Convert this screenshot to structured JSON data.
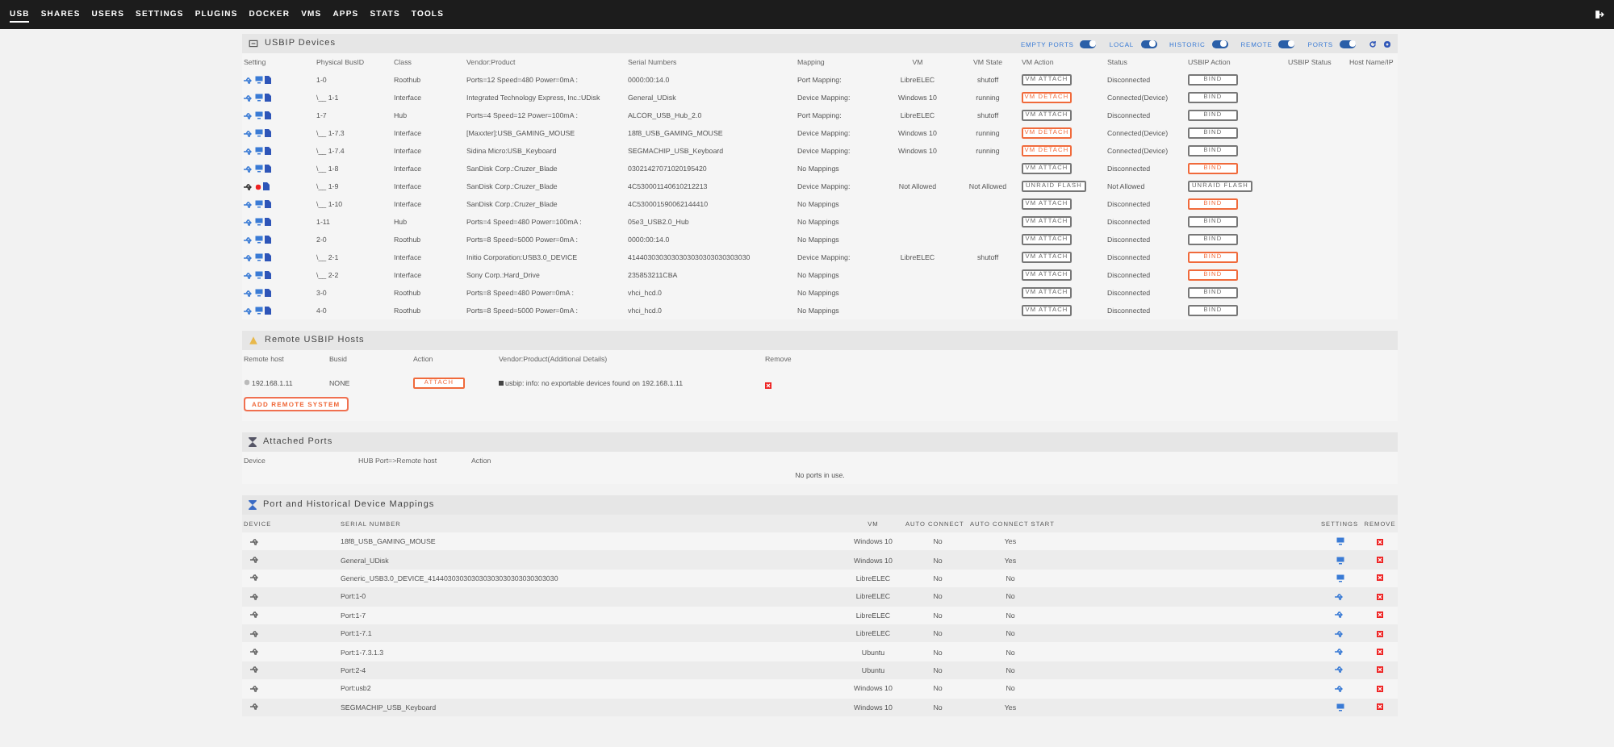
{
  "nav": [
    {
      "label": "USB",
      "selected": true
    },
    {
      "label": "SHARES",
      "selected": false
    },
    {
      "label": "USERS",
      "selected": false
    },
    {
      "label": "SETTINGS",
      "selected": false
    },
    {
      "label": "PLUGINS",
      "selected": false
    },
    {
      "label": "DOCKER",
      "selected": false
    },
    {
      "label": "VMS",
      "selected": false
    },
    {
      "label": "APPS",
      "selected": false
    },
    {
      "label": "STATS",
      "selected": false
    },
    {
      "label": "TOOLS",
      "selected": false
    }
  ],
  "devices": {
    "title": "USBIP Devices",
    "toggles": [
      {
        "label": "EMPTY PORTS",
        "on": true
      },
      {
        "label": "LOCAL",
        "on": true
      },
      {
        "label": "HISTORIC",
        "on": true
      },
      {
        "label": "REMOTE",
        "on": true
      },
      {
        "label": "PORTS",
        "on": true
      }
    ],
    "columns": [
      "Setting",
      "Physical BusID",
      "Class",
      "Vendor:Product",
      "Serial Numbers",
      "Mapping",
      "VM",
      "VM State",
      "VM Action",
      "Status",
      "USBIP Action",
      "USBIP Status",
      "Host Name/IP"
    ],
    "rows": [
      {
        "vm_allowed": true,
        "busid": "1-0",
        "class": "Roothub",
        "vendor": "Ports=12 Speed=480 Power=0mA :",
        "serial": "0000:00:14.0",
        "mapping": "Port Mapping:",
        "vm": "LibreELEC",
        "vm_state": "shutoff",
        "vm_action": {
          "label": "VM ATTACH",
          "kind": "attach"
        },
        "status": "Disconnected",
        "usbip_action": {
          "label": "BIND",
          "highlighted": false
        }
      },
      {
        "vm_allowed": true,
        "busid": "\\__ 1-1",
        "class": "Interface",
        "vendor": "Integrated Technology Express, Inc.:UDisk",
        "serial": "General_UDisk",
        "mapping": "Device Mapping:",
        "vm": "Windows 10",
        "vm_state": "running",
        "vm_action": {
          "label": "VM DETACH",
          "kind": "detach"
        },
        "status": "Connected(Device)",
        "usbip_action": {
          "label": "BIND",
          "highlighted": false
        }
      },
      {
        "vm_allowed": true,
        "busid": "1-7",
        "class": "Hub",
        "vendor": "Ports=4 Speed=12 Power=100mA :",
        "serial": "ALCOR_USB_Hub_2.0",
        "mapping": "Port Mapping:",
        "vm": "LibreELEC",
        "vm_state": "shutoff",
        "vm_action": {
          "label": "VM ATTACH",
          "kind": "attach"
        },
        "status": "Disconnected",
        "usbip_action": {
          "label": "BIND",
          "highlighted": false
        }
      },
      {
        "vm_allowed": true,
        "busid": "\\__ 1-7.3",
        "class": "Interface",
        "vendor": "[Maxxter]:USB_GAMING_MOUSE",
        "serial": "18f8_USB_GAMING_MOUSE",
        "mapping": "Device Mapping:",
        "vm": "Windows 10",
        "vm_state": "running",
        "vm_action": {
          "label": "VM DETACH",
          "kind": "detach"
        },
        "status": "Connected(Device)",
        "usbip_action": {
          "label": "BIND",
          "highlighted": false
        }
      },
      {
        "vm_allowed": true,
        "busid": "\\__ 1-7.4",
        "class": "Interface",
        "vendor": "Sidina Micro:USB_Keyboard",
        "serial": "SEGMACHIP_USB_Keyboard",
        "mapping": "Device Mapping:",
        "vm": "Windows 10",
        "vm_state": "running",
        "vm_action": {
          "label": "VM DETACH",
          "kind": "detach"
        },
        "status": "Connected(Device)",
        "usbip_action": {
          "label": "BIND",
          "highlighted": false
        }
      },
      {
        "vm_allowed": true,
        "busid": "\\__ 1-8",
        "class": "Interface",
        "vendor": "SanDisk Corp.:Cruzer_Blade",
        "serial": "03021427071020195420",
        "mapping": "No Mappings",
        "vm": "",
        "vm_state": "",
        "vm_action": {
          "label": "VM ATTACH",
          "kind": "attach"
        },
        "status": "Disconnected",
        "usbip_action": {
          "label": "BIND",
          "highlighted": true
        }
      },
      {
        "vm_allowed": false,
        "busid": "\\__ 1-9",
        "class": "Interface",
        "vendor": "SanDisk Corp.:Cruzer_Blade",
        "serial": "4C530001140610212213",
        "mapping": "Device Mapping:",
        "vm": "Not Allowed",
        "vm_state": "Not Allowed",
        "vm_action": {
          "label": "UNRAID FLASH",
          "kind": "flash"
        },
        "status": "Not Allowed",
        "usbip_action": {
          "label": "UNRAID FLASH",
          "highlighted": false
        }
      },
      {
        "vm_allowed": true,
        "busid": "\\__ 1-10",
        "class": "Interface",
        "vendor": "SanDisk Corp.:Cruzer_Blade",
        "serial": "4C530001590062144410",
        "mapping": "No Mappings",
        "vm": "",
        "vm_state": "",
        "vm_action": {
          "label": "VM ATTACH",
          "kind": "attach"
        },
        "status": "Disconnected",
        "usbip_action": {
          "label": "BIND",
          "highlighted": true
        }
      },
      {
        "vm_allowed": true,
        "busid": "1-11",
        "class": "Hub",
        "vendor": "Ports=4 Speed=480 Power=100mA :",
        "serial": "05e3_USB2.0_Hub",
        "mapping": "No Mappings",
        "vm": "",
        "vm_state": "",
        "vm_action": {
          "label": "VM ATTACH",
          "kind": "attach"
        },
        "status": "Disconnected",
        "usbip_action": {
          "label": "BIND",
          "highlighted": false
        }
      },
      {
        "vm_allowed": true,
        "busid": "2-0",
        "class": "Roothub",
        "vendor": "Ports=8 Speed=5000 Power=0mA :",
        "serial": "0000:00:14.0",
        "mapping": "No Mappings",
        "vm": "",
        "vm_state": "",
        "vm_action": {
          "label": "VM ATTACH",
          "kind": "attach"
        },
        "status": "Disconnected",
        "usbip_action": {
          "label": "BIND",
          "highlighted": false
        }
      },
      {
        "vm_allowed": true,
        "busid": "\\__ 2-1",
        "class": "Interface",
        "vendor": "Initio Corporation:USB3.0_DEVICE",
        "serial": "4144030303030303030303030303030",
        "mapping": "Device Mapping:",
        "vm": "LibreELEC",
        "vm_state": "shutoff",
        "vm_action": {
          "label": "VM ATTACH",
          "kind": "attach"
        },
        "status": "Disconnected",
        "usbip_action": {
          "label": "BIND",
          "highlighted": true
        }
      },
      {
        "vm_allowed": true,
        "busid": "\\__ 2-2",
        "class": "Interface",
        "vendor": "Sony Corp.:Hard_Drive",
        "serial": "235853211CBA",
        "mapping": "No Mappings",
        "vm": "",
        "vm_state": "",
        "vm_action": {
          "label": "VM ATTACH",
          "kind": "attach"
        },
        "status": "Disconnected",
        "usbip_action": {
          "label": "BIND",
          "highlighted": true
        }
      },
      {
        "vm_allowed": true,
        "busid": "3-0",
        "class": "Roothub",
        "vendor": "Ports=8 Speed=480 Power=0mA :",
        "serial": "vhci_hcd.0",
        "mapping": "No Mappings",
        "vm": "",
        "vm_state": "",
        "vm_action": {
          "label": "VM ATTACH",
          "kind": "attach"
        },
        "status": "Disconnected",
        "usbip_action": {
          "label": "BIND",
          "highlighted": false
        }
      },
      {
        "vm_allowed": true,
        "busid": "4-0",
        "class": "Roothub",
        "vendor": "Ports=8 Speed=5000 Power=0mA :",
        "serial": "vhci_hcd.0",
        "mapping": "No Mappings",
        "vm": "",
        "vm_state": "",
        "vm_action": {
          "label": "VM ATTACH",
          "kind": "attach"
        },
        "status": "Disconnected",
        "usbip_action": {
          "label": "BIND",
          "highlighted": false
        }
      }
    ]
  },
  "remote": {
    "title": "Remote USBIP Hosts",
    "columns": [
      "Remote host",
      "Busid",
      "Action",
      "Vendor:Product(Additional Details)",
      "Remove"
    ],
    "rows": [
      {
        "host": "192.168.1.11",
        "busid": "NONE",
        "action": "ATTACH",
        "details": "usbip: info: no exportable devices found on 192.168.1.11"
      }
    ],
    "add_button": "ADD REMOTE SYSTEM"
  },
  "attached": {
    "title": "Attached Ports",
    "columns": [
      "Device",
      "HUB Port=>Remote host",
      "Action"
    ],
    "empty_text": "No ports in use."
  },
  "mappings": {
    "title": "Port and Historical Device Mappings",
    "columns": [
      "DEVICE",
      "SERIAL NUMBER",
      "VM",
      "AUTO CONNECT",
      "AUTO CONNECT START",
      "SETTINGS",
      "REMOVE"
    ],
    "rows": [
      {
        "serial": "18f8_USB_GAMING_MOUSE",
        "vm": "Windows 10",
        "auto_connect": "No",
        "auto_connect_start": "Yes",
        "kind": "device"
      },
      {
        "serial": "General_UDisk",
        "vm": "Windows 10",
        "auto_connect": "No",
        "auto_connect_start": "Yes",
        "kind": "device"
      },
      {
        "serial": "Generic_USB3.0_DEVICE_414403030303030303030303030303030",
        "vm": "LibreELEC",
        "auto_connect": "No",
        "auto_connect_start": "No",
        "kind": "device"
      },
      {
        "serial": "Port:1-0",
        "vm": "LibreELEC",
        "auto_connect": "No",
        "auto_connect_start": "No",
        "kind": "port"
      },
      {
        "serial": "Port:1-7",
        "vm": "LibreELEC",
        "auto_connect": "No",
        "auto_connect_start": "No",
        "kind": "port"
      },
      {
        "serial": "Port:1-7.1",
        "vm": "LibreELEC",
        "auto_connect": "No",
        "auto_connect_start": "No",
        "kind": "port"
      },
      {
        "serial": "Port:1-7.3.1.3",
        "vm": "Ubuntu",
        "auto_connect": "No",
        "auto_connect_start": "No",
        "kind": "port"
      },
      {
        "serial": "Port:2-4",
        "vm": "Ubuntu",
        "auto_connect": "No",
        "auto_connect_start": "No",
        "kind": "port"
      },
      {
        "serial": "Port:usb2",
        "vm": "Windows 10",
        "auto_connect": "No",
        "auto_connect_start": "No",
        "kind": "port"
      },
      {
        "serial": "SEGMACHIP_USB_Keyboard",
        "vm": "Windows 10",
        "auto_connect": "No",
        "auto_connect_start": "Yes",
        "kind": "device"
      }
    ]
  }
}
